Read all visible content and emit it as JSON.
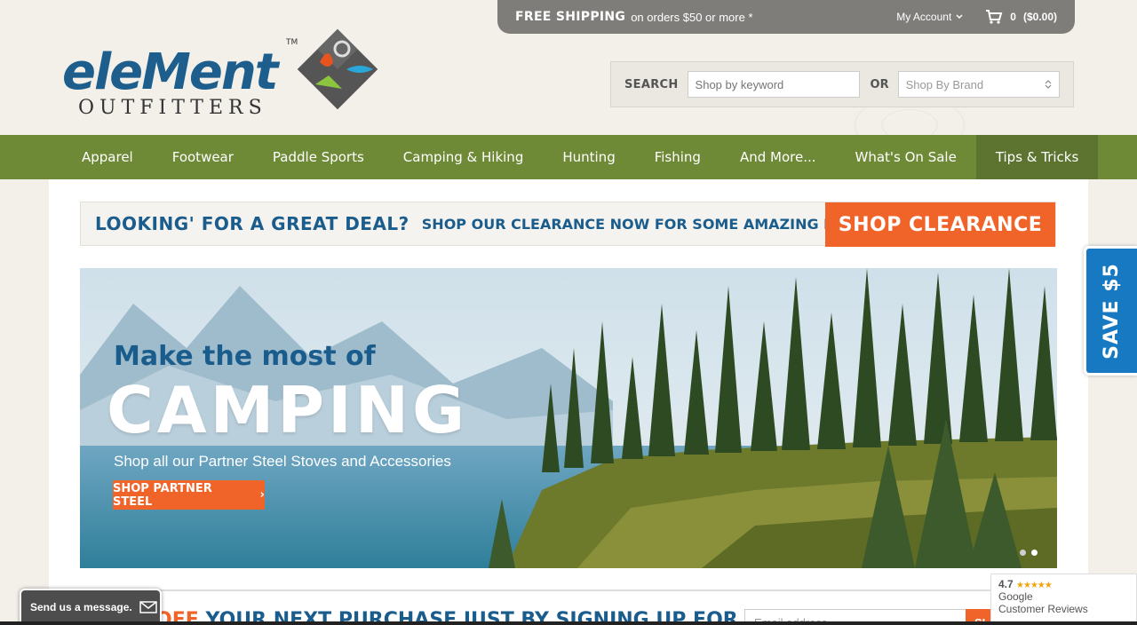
{
  "topbar": {
    "free_shipping": "FREE SHIPPING",
    "free_sub": "on orders $50 or more *",
    "account": "My Account",
    "cart_count": "0",
    "cart_total": "($0.00)"
  },
  "logo": {
    "word1": "eleMent",
    "word2": "OUTFITTERS",
    "tm": "TM"
  },
  "search": {
    "label": "SEARCH",
    "placeholder": "Shop by keyword",
    "or": "OR",
    "brand_placeholder": "Shop By Brand"
  },
  "nav": {
    "items": [
      "Apparel",
      "Footwear",
      "Paddle Sports",
      "Camping & Hiking",
      "Hunting",
      "Fishing",
      "And More...",
      "What's On Sale",
      "Tips & Tricks"
    ]
  },
  "deal": {
    "headline": "LOOKING' FOR A GREAT DEAL?",
    "sub": "SHOP OUR CLEARANCE NOW FOR SOME AMAZING DEALS!",
    "button": "SHOP CLEARANCE"
  },
  "hero": {
    "line1": "Make the most of",
    "line2": "CAMPING",
    "line3": "Shop all our Partner Steel Stoves and Accessories",
    "cta": "SHOP PARTNER STEEL",
    "cta_arrow": "›"
  },
  "newsletter": {
    "off": "OFF",
    "text": "YOUR NEXT PURCHASE JUST BY SIGNING UP FOR OUR NEWSLETTER!",
    "email_placeholder": "Email address",
    "signup": "SI"
  },
  "save": {
    "label": "SAVE $5"
  },
  "message": {
    "label": "Send us a message."
  },
  "reviews": {
    "score": "4.7",
    "stars": "★★★★★",
    "brand": "Google",
    "label": "Customer Reviews"
  },
  "colors": {
    "nav_green": "#6f8a36",
    "accent_orange": "#f0642a",
    "brand_blue": "#1a5c8c"
  }
}
